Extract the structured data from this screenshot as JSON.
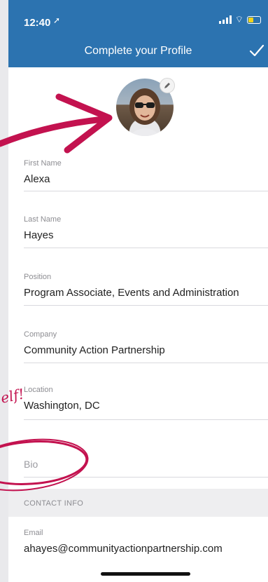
{
  "status_bar": {
    "time": "12:40",
    "location_arrow": "location-arrow-icon"
  },
  "nav": {
    "title": "Complete your Profile",
    "done_icon": "checkmark-icon"
  },
  "avatar": {
    "edit_icon": "pencil-icon"
  },
  "fields": {
    "first_name": {
      "label": "First Name",
      "value": "Alexa"
    },
    "last_name": {
      "label": "Last Name",
      "value": "Hayes"
    },
    "position": {
      "label": "Position",
      "value": "Program Associate, Events and Administration"
    },
    "company": {
      "label": "Company",
      "value": "Community Action Partnership"
    },
    "location": {
      "label": "Location",
      "value": "Washington, DC"
    },
    "bio": {
      "placeholder": "Bio"
    },
    "email": {
      "label": "Email",
      "value": "ahayes@communityactionpartnership.com"
    }
  },
  "sections": {
    "contact_info": "CONTACT INFO"
  },
  "annotation": {
    "handwritten": "elf!"
  },
  "colors": {
    "nav_bar": "#2c73b0",
    "annotation": "#c3124f"
  }
}
